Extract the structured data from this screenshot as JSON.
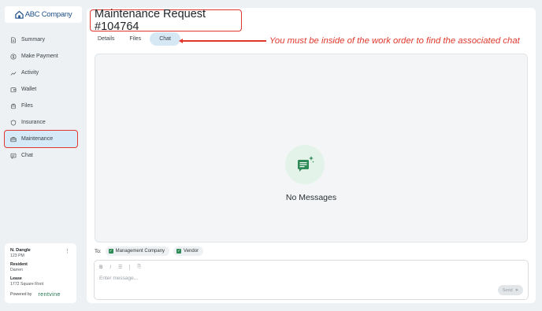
{
  "app": {
    "logo_text": "ABC Company"
  },
  "sidebar": {
    "items": [
      {
        "label": "Summary",
        "icon": "document-icon"
      },
      {
        "label": "Make Payment",
        "icon": "dollar-icon"
      },
      {
        "label": "Activity",
        "icon": "trend-icon"
      },
      {
        "label": "Wallet",
        "icon": "wallet-icon"
      },
      {
        "label": "Files",
        "icon": "folder-icon"
      },
      {
        "label": "Insurance",
        "icon": "shield-icon"
      },
      {
        "label": "Maintenance",
        "icon": "toolbox-icon",
        "active": true
      },
      {
        "label": "Chat",
        "icon": "chat-icon"
      }
    ]
  },
  "user": {
    "name": "N. Dangle",
    "unit": "123 PM",
    "resident_label": "Resident",
    "resident_value": "Darren",
    "lease_label": "Lease",
    "lease_value": "1772 Square Root",
    "powered_by": "Powered by",
    "brand": "rentvine"
  },
  "main": {
    "title": "Maintenance Request #104764",
    "tabs": [
      {
        "label": "Details"
      },
      {
        "label": "Files"
      },
      {
        "label": "Chat",
        "active": true
      }
    ],
    "annotation": "You must be inside of the work order to find the associated chat",
    "empty_state": "No Messages",
    "to_label": "To:",
    "recipients": [
      "Management Company",
      "Vendor"
    ],
    "composer": {
      "placeholder": "Enter message...",
      "send_label": "Send"
    }
  },
  "colors": {
    "accent": "#e0382e",
    "active_bg": "#d6e9f7",
    "brand_green": "#2e8b57",
    "logo_blue": "#1f4f86"
  }
}
